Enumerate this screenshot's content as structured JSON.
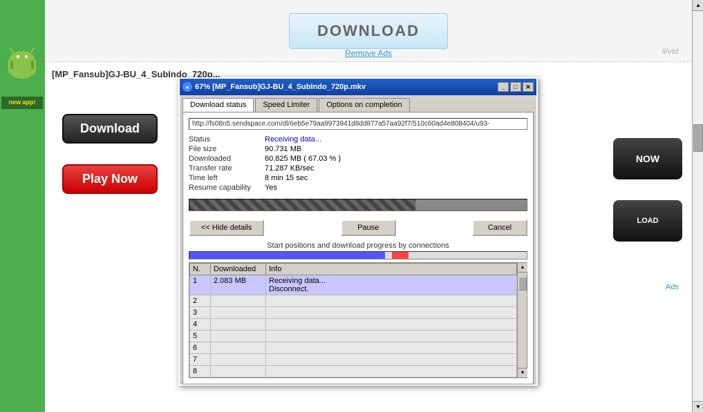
{
  "page": {
    "title": "67% [MP_Fansub]GJ-BU_4_SubIndo_720p.mkv",
    "background_color": "#ffffff"
  },
  "banner": {
    "download_label": "DOWNLOAD",
    "remove_ads": "Remove Ads",
    "iliVid": "iliVid"
  },
  "page_title": "[MP_Fansub]GJ-BU_4_SubIndo_720p...",
  "buttons": {
    "download": "Download",
    "play_now": "Play Now",
    "now": "NOW",
    "load": "LOAD"
  },
  "ads": "Ads",
  "dialog": {
    "title": "67% [MP_Fansub]GJ-BU_4_SubIndo_720p.mkv",
    "tabs": [
      {
        "id": "download-status",
        "label": "Download status",
        "active": true
      },
      {
        "id": "speed-limiter",
        "label": "Speed Limiter",
        "active": false
      },
      {
        "id": "options-on-completion",
        "label": "Options on completion",
        "active": false
      }
    ],
    "url": "http://fs08n5.sendspace.com/dl/6eb5e79aa9973941d8dd877a57aa92f7/510c60ad4e808404/u93-",
    "status_label": "Status",
    "status_value": "Receiving data...",
    "file_size_label": "File size",
    "file_size_value": "90.731  MB",
    "downloaded_label": "Downloaded",
    "downloaded_value": "60.825  MB  ( 67.03 % )",
    "transfer_rate_label": "Transfer rate",
    "transfer_rate_value": "71.287  KB/sec",
    "time_left_label": "Time left",
    "time_left_value": "8 min 15 sec",
    "resume_label": "Resume capability",
    "resume_value": "Yes",
    "progress_percent": 67,
    "buttons": {
      "hide_details": "<< Hide details",
      "pause": "Pause",
      "cancel": "Cancel"
    },
    "connections_label": "Start positions and download progress by connections",
    "table": {
      "headers": [
        "N.",
        "Downloaded",
        "Info"
      ],
      "rows": [
        {
          "n": "1",
          "downloaded": "2.083  MB",
          "info": "Receiving data...\nDisconnect."
        },
        {
          "n": "2",
          "downloaded": "",
          "info": ""
        },
        {
          "n": "3",
          "downloaded": "",
          "info": ""
        },
        {
          "n": "4",
          "downloaded": "",
          "info": ""
        },
        {
          "n": "5",
          "downloaded": "",
          "info": ""
        },
        {
          "n": "6",
          "downloaded": "",
          "info": ""
        },
        {
          "n": "7",
          "downloaded": "",
          "info": ""
        },
        {
          "n": "8",
          "downloaded": "",
          "info": ""
        }
      ]
    }
  }
}
